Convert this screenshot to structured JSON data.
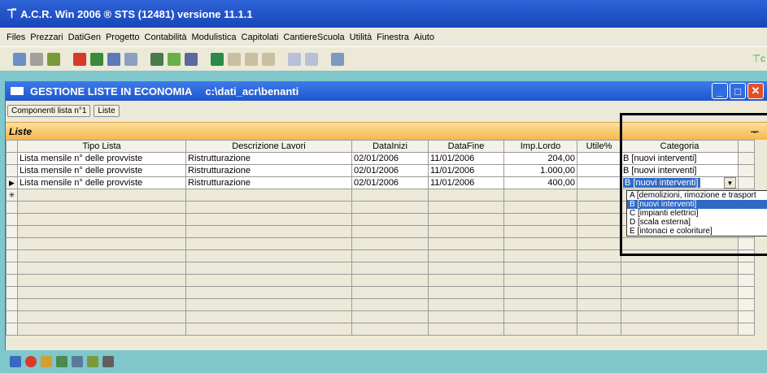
{
  "app": {
    "title": "A.C.R. Win 2006 ®    STS (12481) versione 11.1.1"
  },
  "menu": [
    "Files",
    "Prezzari",
    "DatiGen",
    "Progetto",
    "Contabilità",
    "Modulistica",
    "Capitolati",
    "CantiereScuola",
    "Utilità",
    "Finestra",
    "Aiuto"
  ],
  "window": {
    "title": "GESTIONE LISTE IN ECONOMIA",
    "path": "c:\\dati_acr\\benanti",
    "tabs": [
      "Componenti lista n°1",
      "Liste"
    ]
  },
  "panel": {
    "title": "Liste",
    "pin": "ᅮ"
  },
  "table": {
    "columns": [
      "Tipo Lista",
      "Descrizione Lavori",
      "DataInizi",
      "DataFine",
      "Imp.Lordo",
      "Utile%",
      "Categoria"
    ],
    "rows": [
      {
        "tipo": "Lista mensile n°  delle provviste",
        "descr": "Ristrutturazione",
        "inizio": "02/01/2006",
        "fine": "11/01/2006",
        "imp": "204,00",
        "utile": "",
        "cat": "B  [nuovi interventi]"
      },
      {
        "tipo": "Lista mensile n°  delle provviste",
        "descr": "Ristrutturazione",
        "inizio": "02/01/2006",
        "fine": "11/01/2006",
        "imp": "1.000,00",
        "utile": "",
        "cat": "B  [nuovi interventi]"
      },
      {
        "tipo": "Lista mensile n°  delle provviste",
        "descr": "Ristrutturazione",
        "inizio": "02/01/2006",
        "fine": "11/01/2006",
        "imp": "400,00",
        "utile": "",
        "cat": "B  [nuovi interventi]"
      }
    ],
    "new_row_marker": "✳",
    "current_row_marker": "▶"
  },
  "dropdown": {
    "options": [
      "A  [demolizioni, rimozione e trasport",
      "B  [nuovi interventi]",
      "C  [impianti elettrici]",
      "D  [scala esterna]",
      "E  [intonaci e coloriture]"
    ],
    "selected_index": 1
  },
  "icons": {
    "toolbar": [
      "window-icon",
      "copy-icon",
      "logo-icon",
      "close-red-icon",
      "calculator-icon",
      "book-icon",
      "grid-icon",
      "chart-icon",
      "chart2-icon",
      "folder-icon",
      "excel-icon",
      "tools-icon",
      "tools2-icon",
      "tools3-icon",
      "undo-icon",
      "redo-icon",
      "calc2-icon"
    ],
    "bottom": [
      "report-icon",
      "cancel-icon",
      "pencil-icon",
      "edit-icon",
      "notes-icon",
      "filter-icon",
      "print-icon"
    ]
  }
}
